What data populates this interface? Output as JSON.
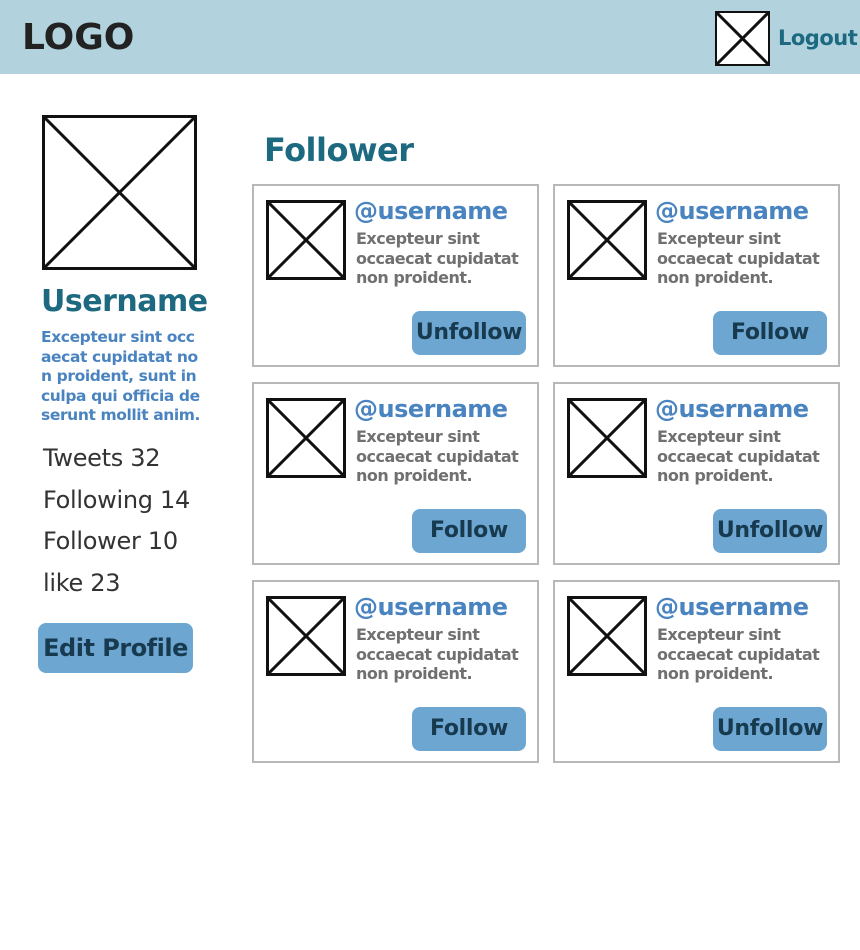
{
  "header": {
    "logo": "LOGO",
    "logout_label": "Logout"
  },
  "profile": {
    "username": "Username",
    "bio": "Excepteur sint occaecat cupidatat non proident, sunt in culpa qui officia deserunt mollit anim.",
    "stats": {
      "tweets": "Tweets 32",
      "following": "Following 14",
      "follower": "Follower 10",
      "like": "like 23"
    },
    "edit_label": "Edit Profile"
  },
  "main": {
    "title": "Follower",
    "followers": [
      {
        "handle": "@username",
        "description": "Excepteur sint occaecat cupidatat non proident.",
        "action": "Unfollow"
      },
      {
        "handle": "@username",
        "description": "Excepteur sint occaecat cupidatat non proident.",
        "action": "Follow"
      },
      {
        "handle": "@username",
        "description": "Excepteur sint occaecat cupidatat non proident.",
        "action": "Follow"
      },
      {
        "handle": "@username",
        "description": "Excepteur sint occaecat cupidatat non proident.",
        "action": "Unfollow"
      },
      {
        "handle": "@username",
        "description": "Excepteur sint occaecat cupidatat non proident.",
        "action": "Follow"
      },
      {
        "handle": "@username",
        "description": "Excepteur sint occaecat cupidatat non proident.",
        "action": "Unfollow"
      }
    ]
  },
  "colors": {
    "header_bg": "#b2d2de",
    "accent_dark": "#1d6a80",
    "accent_blue": "#4a84c0",
    "button_bg": "#6ea6d2"
  },
  "icons": {
    "image_placeholder": "image-placeholder-icon"
  }
}
